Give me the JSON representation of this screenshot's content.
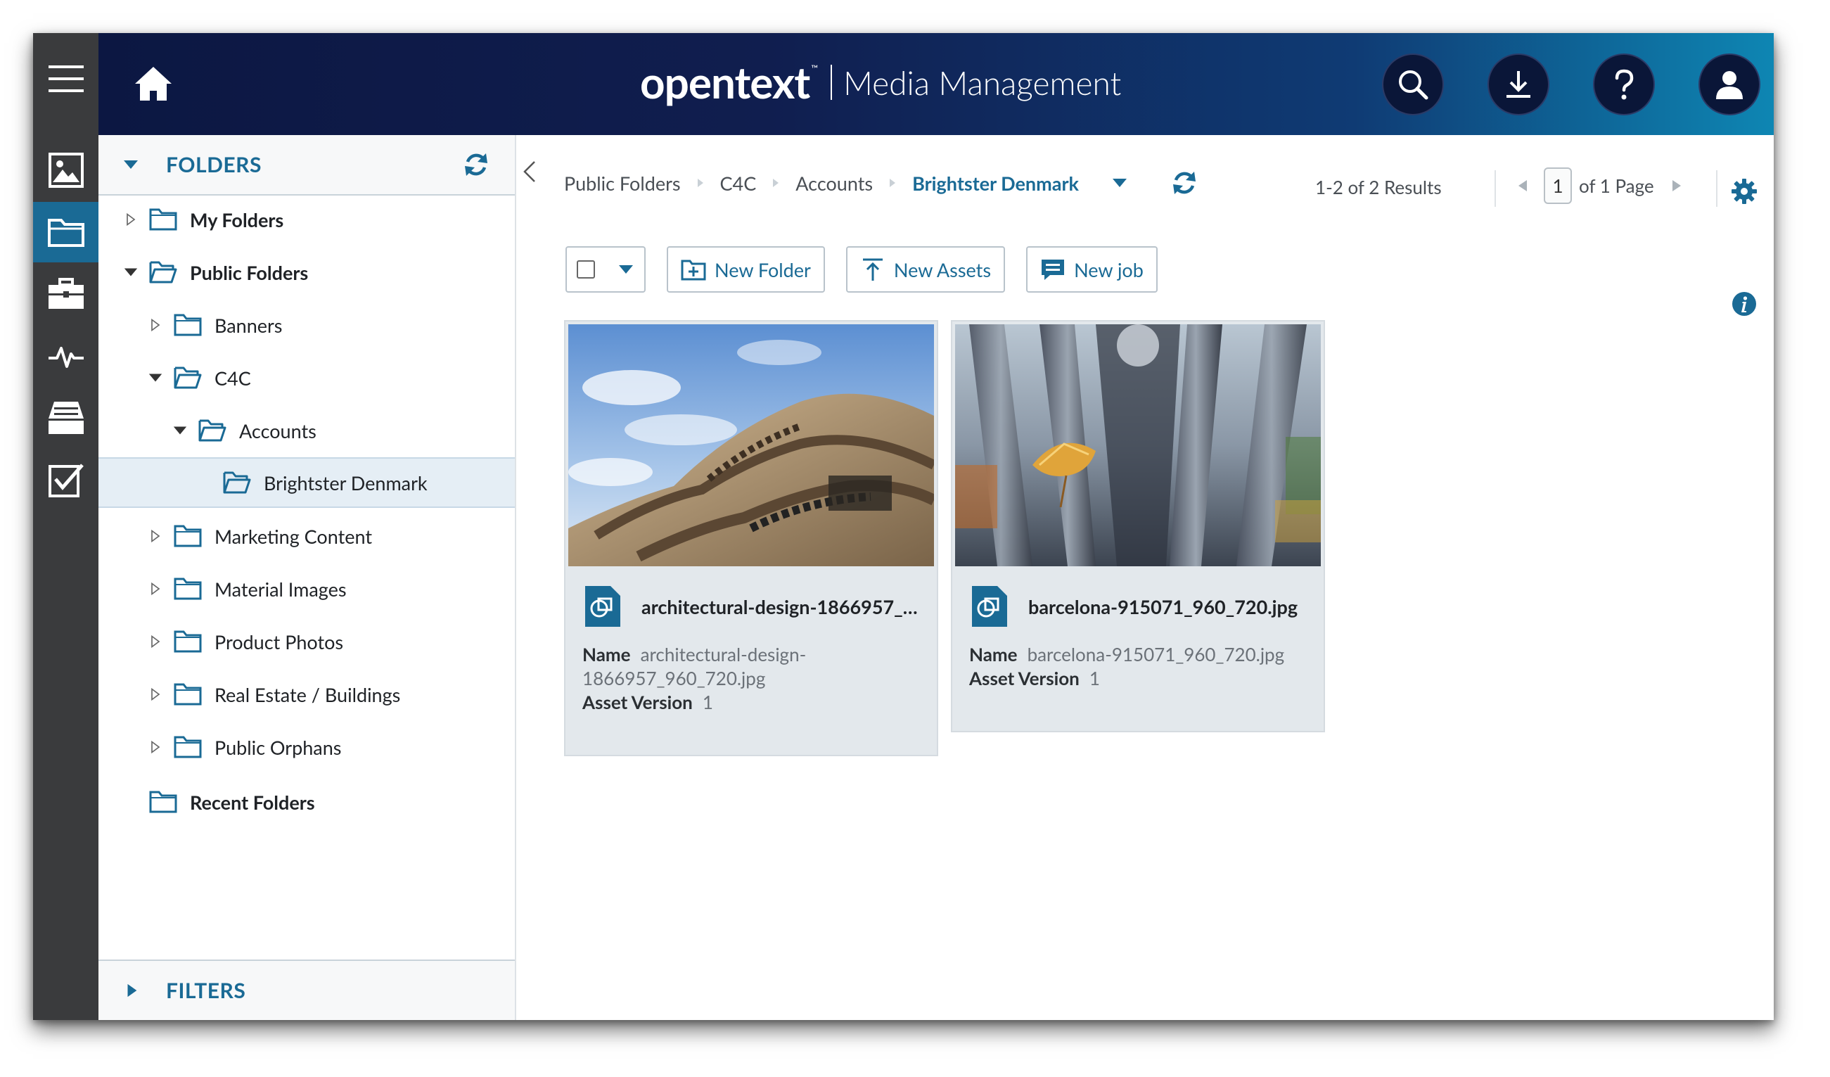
{
  "header": {
    "logo": "opentext",
    "trademark": "™",
    "product": "Media Management"
  },
  "sidebar": {
    "folders_title": "FOLDERS",
    "filters_title": "FILTERS",
    "tree": [
      {
        "label": "My Folders"
      },
      {
        "label": "Public Folders"
      },
      {
        "label": "Banners"
      },
      {
        "label": "C4C"
      },
      {
        "label": "Accounts"
      },
      {
        "label": "Brightster Denmark"
      },
      {
        "label": "Marketing Content"
      },
      {
        "label": "Material Images"
      },
      {
        "label": "Product Photos"
      },
      {
        "label": "Real Estate / Buildings"
      },
      {
        "label": "Public Orphans"
      },
      {
        "label": "Recent Folders"
      }
    ]
  },
  "breadcrumb": {
    "items": [
      "Public Folders",
      "C4C",
      "Accounts"
    ],
    "current": "Brightster Denmark"
  },
  "results": {
    "summary": "1-2 of 2 Results",
    "page": "1",
    "page_suffix": "of 1 Page"
  },
  "toolbar": {
    "new_folder": "New Folder",
    "new_assets": "New Assets",
    "new_job": "New job"
  },
  "assets": [
    {
      "title": "architectural-design-1866957_9...",
      "name_label": "Name",
      "name_line1": "architectural-design-",
      "name_line2": "1866957_960_720.jpg",
      "version_label": "Asset Version",
      "version": "1"
    },
    {
      "title": "barcelona-915071_960_720.jpg",
      "name_label": "Name",
      "name_line1": "barcelona-915071_960_720.jpg",
      "version_label": "Asset Version",
      "version": "1"
    }
  ],
  "colors": {
    "accent": "#1a6a95",
    "rail": "#3a3b3d",
    "header_start": "#0c1742",
    "header_end": "#0e86b3"
  }
}
